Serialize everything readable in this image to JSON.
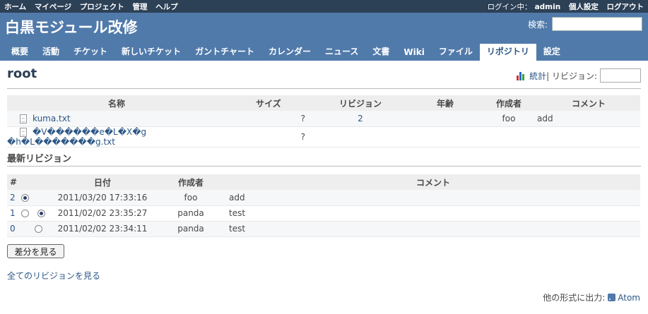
{
  "top_menu": {
    "left": [
      "ホーム",
      "マイページ",
      "プロジェクト",
      "管理",
      "ヘルプ"
    ],
    "logged_in_prefix": "ログイン中：",
    "username": "admin",
    "my_account": "個人設定",
    "logout": "ログアウト"
  },
  "header": {
    "title": "白黒モジュール改修",
    "search_label": "検索:",
    "search_value": ""
  },
  "main_menu": {
    "tabs": [
      "概要",
      "活動",
      "チケット",
      "新しいチケット",
      "ガントチャート",
      "カレンダー",
      "ニュース",
      "文書",
      "Wiki",
      "ファイル",
      "リポジトリ",
      "設定"
    ],
    "selected": "リポジトリ"
  },
  "page": {
    "title": "root",
    "stats_link": "統計",
    "revision_label": " | リビジョン:",
    "revision_value": ""
  },
  "files_table": {
    "headers": [
      "名称",
      "サイズ",
      "リビジョン",
      "年齢",
      "作成者",
      "コメント"
    ],
    "rows": [
      {
        "name": "kuma.txt",
        "size": "?",
        "revision": "2",
        "age": "",
        "author": "foo",
        "comment": "add"
      },
      {
        "name": "�V������e�L�X�g �h�L�������g.txt",
        "size": "?",
        "revision": "",
        "age": "",
        "author": "",
        "comment": ""
      }
    ]
  },
  "latest_revisions": {
    "title": "最新リビジョン",
    "headers": [
      "#",
      "日付",
      "作成者",
      "コメント"
    ],
    "rows": [
      {
        "id": "2",
        "radio1": true,
        "radio2": false,
        "show_radio1": true,
        "show_radio2": false,
        "date": "2011/03/20 17:33:16",
        "author": "foo",
        "comment": "add"
      },
      {
        "id": "1",
        "radio1": false,
        "radio2": true,
        "show_radio1": true,
        "show_radio2": true,
        "date": "2011/02/02 23:35:27",
        "author": "panda",
        "comment": "test"
      },
      {
        "id": "0",
        "radio1": false,
        "radio2": false,
        "show_radio1": false,
        "show_radio2": true,
        "date": "2011/02/02 23:34:11",
        "author": "panda",
        "comment": "test"
      }
    ],
    "diff_button": "差分を見る",
    "view_all": "全てのリビジョンを見る"
  },
  "footer": {
    "other_formats": "他の形式に出力:",
    "atom": "Atom"
  },
  "colors": {
    "header_bg": "#507aaa",
    "top_menu_bg": "#2c4056",
    "link": "#2a5685"
  }
}
